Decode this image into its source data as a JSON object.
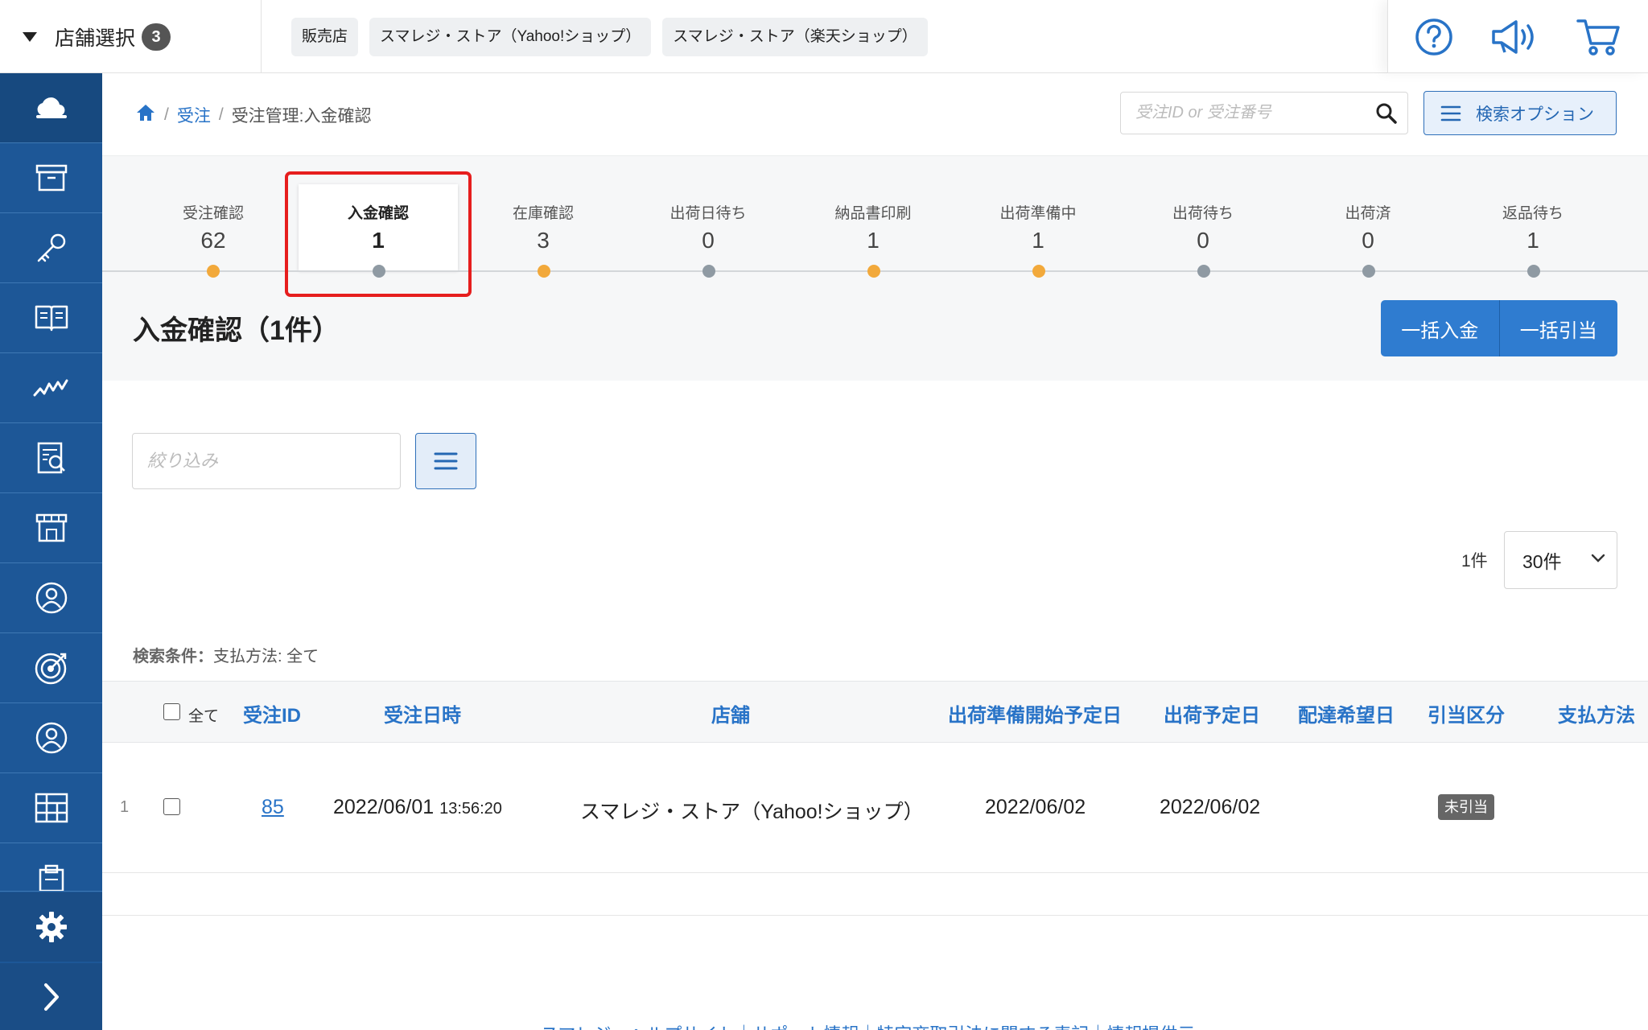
{
  "header": {
    "store_select_label": "店舗選択",
    "store_select_count": "3",
    "store_tags": [
      "販売店",
      "スマレジ・ストア（Yahoo!ショップ）",
      "スマレジ・ストア（楽天ショップ）"
    ],
    "icons": [
      "help-icon",
      "megaphone-icon",
      "cart-icon"
    ]
  },
  "sidebar": {
    "items": [
      "cloud-icon",
      "archive-icon",
      "key-icon",
      "book-icon",
      "trend-icon",
      "report-icon",
      "store-icon",
      "user-icon",
      "target-icon",
      "person-icon",
      "grid-icon",
      "clipboard-icon"
    ],
    "bottom": [
      "gear-icon",
      "chevron-right-icon"
    ]
  },
  "breadcrumb": {
    "items": [
      "受注",
      "受注管理:入金確認"
    ]
  },
  "search": {
    "placeholder": "受注ID or 受注番号",
    "option_label": "検索オプション"
  },
  "status_tabs": [
    {
      "label": "受注確認",
      "count": "62",
      "dot": "orange"
    },
    {
      "label": "入金確認",
      "count": "1",
      "dot": "gray",
      "active": true
    },
    {
      "label": "在庫確認",
      "count": "3",
      "dot": "orange"
    },
    {
      "label": "出荷日待ち",
      "count": "0",
      "dot": "gray"
    },
    {
      "label": "納品書印刷",
      "count": "1",
      "dot": "orange"
    },
    {
      "label": "出荷準備中",
      "count": "1",
      "dot": "orange"
    },
    {
      "label": "出荷待ち",
      "count": "0",
      "dot": "gray"
    },
    {
      "label": "出荷済",
      "count": "0",
      "dot": "gray"
    },
    {
      "label": "返品待ち",
      "count": "1",
      "dot": "gray"
    }
  ],
  "section": {
    "title": "入金確認（1件）",
    "bulk_payment": "一括入金",
    "bulk_allocate": "一括引当"
  },
  "filter": {
    "placeholder": "絞り込み"
  },
  "pagination": {
    "count": "1件",
    "per_page": "30件"
  },
  "search_condition": {
    "key": "検索条件：",
    "value": "支払方法: 全て"
  },
  "table": {
    "select_all": "全て",
    "columns": [
      "受注ID",
      "受注日時",
      "店舗",
      "出荷準備開始予定日",
      "出荷予定日",
      "配達希望日",
      "引当区分",
      "支払方法"
    ],
    "rows": [
      {
        "index": "1",
        "order_id": "85",
        "date": "2022/06/01",
        "time": "13:56:20",
        "store": "スマレジ・ストア（Yahoo!ショップ）",
        "prep_date": "2022/06/02",
        "ship_date": "2022/06/02",
        "delivery_date": "",
        "allocation": "未引当",
        "payment": ""
      }
    ]
  },
  "footer": {
    "links": "スマレジ・ヘルプサイト｜サポート情報｜特定商取引法に関する表記｜情報提供元"
  },
  "colors": {
    "sidebar": "#1d5797",
    "accent": "#2873c7",
    "button": "#2f7cd0",
    "highlight": "#e61e1e",
    "dot_orange": "#f2a93b",
    "dot_gray": "#8f9aa3"
  }
}
